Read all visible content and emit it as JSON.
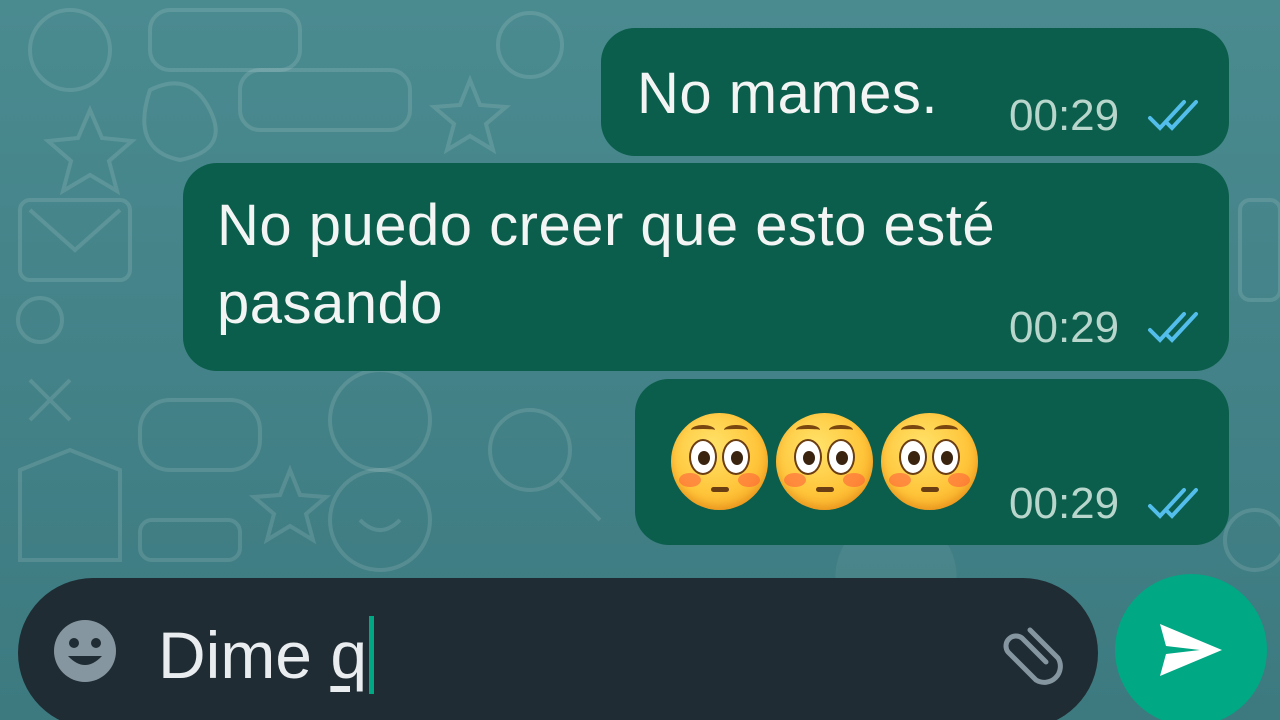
{
  "messages": [
    {
      "text": "No mames.",
      "time": "00:29",
      "status": "read"
    },
    {
      "text": "No puedo creer que esto esté pasando",
      "time": "00:29",
      "status": "read"
    },
    {
      "emojis": [
        "flushed-face",
        "flushed-face",
        "flushed-face"
      ],
      "time": "00:29",
      "status": "read"
    }
  ],
  "composer": {
    "text_prefix": "Dime ",
    "text_underlined": "q"
  },
  "colors": {
    "bubble_outgoing": "#0b5e4b",
    "read_ticks": "#53bdeb",
    "send_button": "#00a884",
    "composer_bg": "#1f2c33",
    "chat_wallpaper": "#3f7f84"
  },
  "icons": {
    "emoji_button": "smiley-icon",
    "attach_button": "paperclip-icon",
    "send_button": "send-icon",
    "status": "double-check-icon"
  }
}
